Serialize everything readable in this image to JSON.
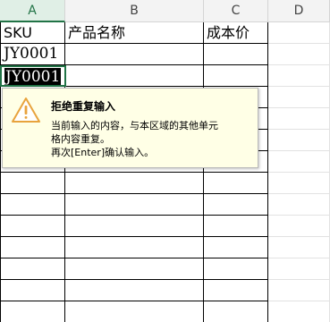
{
  "columns": [
    "A",
    "B",
    "C",
    "D"
  ],
  "rows": [
    [
      "SKU",
      "产品名称",
      "成本价",
      ""
    ],
    [
      "JY0001",
      "",
      "",
      ""
    ],
    [
      "JY0001",
      "",
      "",
      ""
    ]
  ],
  "popup": {
    "title": "拒绝重复输入",
    "message_line1": "当前输入的内容，与本区域的其他单元",
    "message_line2": "格内容重复。",
    "message_line3": "再次[Enter]确认输入。",
    "icon": "warning-icon",
    "icon_color": "#e8a33d"
  },
  "colors": {
    "selection": "#217346",
    "popup_background": "#ffffe6"
  }
}
